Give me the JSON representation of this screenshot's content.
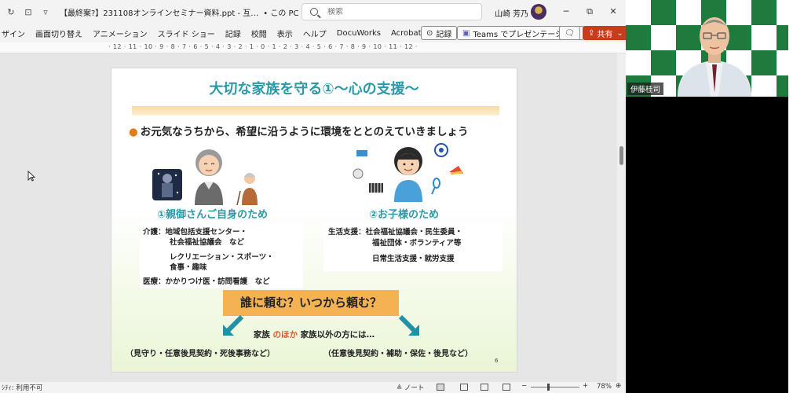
{
  "titlebar": {
    "doc_title": "【最終案?】231108オンラインセミナー資料.ppt - 互…",
    "save_state": "• この PC に保存済み ⌄",
    "search_placeholder": "検索",
    "user_name": "山崎 芳乃",
    "minimize": "─",
    "restore": "⧉",
    "close": "✕"
  },
  "ribbon": {
    "tabs": [
      "ザイン",
      "画面切り替え",
      "アニメーション",
      "スライド ショー",
      "記録",
      "校閲",
      "表示",
      "ヘルプ",
      "DocuWorks",
      "Acrobat"
    ],
    "record_btn": "記録",
    "teams_btn": "Teams でプレゼンテーション",
    "share_btn": "共有"
  },
  "ruler": {
    "marks": "· 12 · 11 · 10 · 9 · 8 · 7 · 6 · 5 · 4 · 3 · 2 · 1 · 0 · 1 · 2 · 3 · 4 · 5 · 6 · 7 · 8 · 9 · 10 · 11 · 12 ·"
  },
  "slide": {
    "title": "大切な家族を守る①～心の支援～",
    "bullet": "お元気なうちから、希望に沿うように環境をととのえていきましょう",
    "left_title": "①親御さんご自身のため",
    "left_items": [
      "介護：地域包括支援センター・",
      "社会福祉協議会　など",
      "レクリエーション・スポーツ・",
      "食事・趣味",
      "医療：かかりつけ医・訪問看護　など"
    ],
    "right_title": "②お子様のため",
    "right_items": [
      "生活支援：社会福祉協議会・民生委員・",
      "福祉団体・ボランティア等",
      "日常生活支援・就労支援"
    ],
    "question": "誰に頼む？いつから頼む？",
    "family_prefix": "家族 ",
    "family_accent": "のほか",
    "family_suffix": " 家族以外の方には…",
    "left_paren": "（見守り・任意後見契約・死後事務など）",
    "right_paren": "（任意後見契約・補助・保佐・後見など）",
    "page_number": "6"
  },
  "statusbar": {
    "accessibility": "ｼﾃｨ: 利用不可",
    "notes": "≜ ノート",
    "zoom": "78%"
  },
  "video": {
    "speaker": "伊藤桂司"
  }
}
